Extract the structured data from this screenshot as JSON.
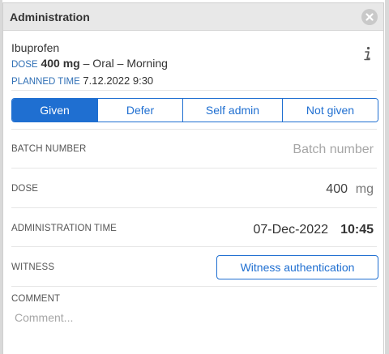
{
  "dialog": {
    "title": "Administration"
  },
  "medication": {
    "name": "Ibuprofen",
    "dose_label": "DOSE",
    "dose_value": "400 mg",
    "route_time": "– Oral – Morning",
    "planned_label": "PLANNED TIME",
    "planned_value": "7.12.2022 9:30"
  },
  "status_options": {
    "items": [
      {
        "label": "Given",
        "active": true
      },
      {
        "label": "Defer",
        "active": false
      },
      {
        "label": "Self admin",
        "active": false
      },
      {
        "label": "Not given",
        "active": false
      }
    ]
  },
  "batch": {
    "label": "BATCH NUMBER",
    "placeholder": "Batch number",
    "value": ""
  },
  "dose": {
    "label": "DOSE",
    "value": "400",
    "unit": "mg"
  },
  "administration_time": {
    "label": "ADMINISTRATION TIME",
    "date": "07-Dec-2022",
    "time": "10:45"
  },
  "witness": {
    "label": "WITNESS",
    "button_label": "Witness authentication"
  },
  "comment": {
    "label": "COMMENT",
    "placeholder": "Comment..."
  },
  "colors": {
    "accent": "#1f6fd1",
    "label_blue": "#2f6fb5",
    "titlebar": "#e8e8e8"
  },
  "icons": {
    "close": "close-circle-icon",
    "info": "info-icon"
  }
}
